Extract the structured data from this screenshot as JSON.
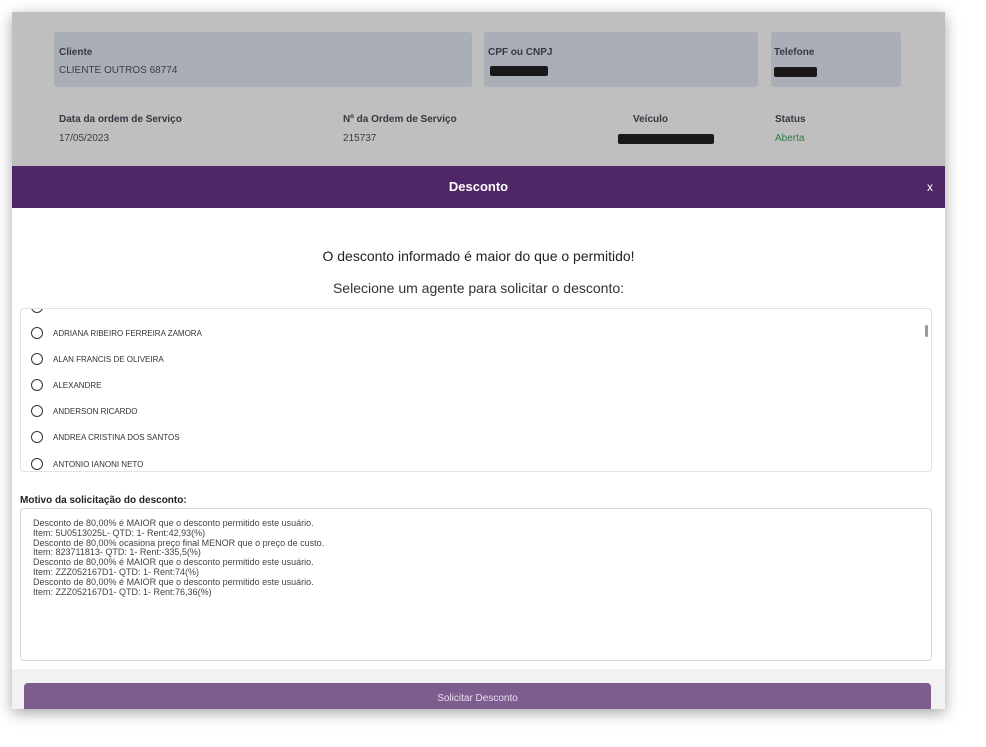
{
  "order": {
    "cliente_label": "Cliente",
    "cliente_value": "CLIENTE OUTROS 68774",
    "cpf_label": "CPF ou CNPJ",
    "telefone_label": "Telefone",
    "data_label": "Data da ordem de Serviço",
    "data_value": "17/05/2023",
    "numero_label": "Nº da Ordem de Serviço",
    "numero_value": "215737",
    "veiculo_label": "Veículo",
    "status_label": "Status",
    "status_value": "Aberta",
    "status_color": "#1e8a3a"
  },
  "modal": {
    "title": "Desconto",
    "close_label": "x",
    "warning": "O desconto informado é maior do que o permitido!",
    "instruction": "Selecione um agente para solicitar o desconto:",
    "header_color": "#4f2766"
  },
  "agents": [
    "ADRIANA RIBEIRO FERREIRA ZAMORA",
    "ALAN FRANCIS DE OLIVEIRA",
    "ALEXANDRE",
    "ANDERSON RICARDO",
    "ANDREA CRISTINA DOS SANTOS",
    "ANTONIO IANONI NETO"
  ],
  "reason": {
    "label": "Motivo da solicitação do desconto:",
    "lines": [
      "Desconto de 80,00% é MAIOR que o desconto permitido este usuário.",
      "Item: 5U0513025L- QTD: 1- Rent:42,93(%)",
      "Desconto de 80,00% ocasiona preço final MENOR que o preço de custo.",
      "Item: 823711813- QTD: 1- Rent:-335,5(%)",
      "Desconto de 80,00% é MAIOR que o desconto permitido este usuário.",
      "Item: ZZZ052167D1- QTD: 1- Rent:74(%)",
      "Desconto de 80,00% é MAIOR que o desconto permitido este usuário.",
      "Item: ZZZ052167D1- QTD: 1- Rent:76,36(%)"
    ]
  },
  "submit": {
    "label": "Solicitar Desconto",
    "color": "#7d5c8e"
  }
}
